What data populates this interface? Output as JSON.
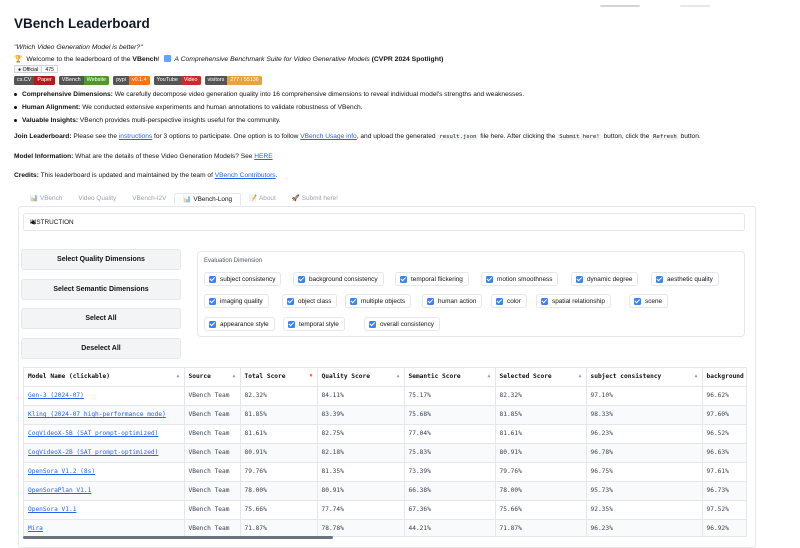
{
  "title": "VBench Leaderboard",
  "quote": "\"Which Video Generation Model is better?\"",
  "welcome": {
    "prefix": "Welcome to the leaderboard of the",
    "name": "VBench",
    "excl": "!",
    "paper_title": "A Comprehensive Benchmark Suite for Video Generative Models",
    "venue": "(CVPR 2024 Spotlight)"
  },
  "github": {
    "label": "Official",
    "count": "475"
  },
  "badges": [
    {
      "left": "cs.CV",
      "right": "Paper",
      "color": "#b31b1b"
    },
    {
      "left": "VBench",
      "right": "Website",
      "color": "#4c9a2a"
    },
    {
      "left": "pypi",
      "right": "v0.1.4",
      "color": "#f97316"
    },
    {
      "left": "YouTube",
      "right": "Video",
      "color": "#cc2b2b"
    },
    {
      "left": "visitors",
      "right": "277 / 55136",
      "color": "#e8a33a"
    }
  ],
  "bullets": [
    {
      "bold": "Comprehensive Dimensions:",
      "text": " We carefully decompose video generation quality into 16 comprehensive dimensions to reveal individual model's strengths and weaknesses."
    },
    {
      "bold": "Human Alignment:",
      "text": " We conducted extensive experiments and human annotations to validate robustness of VBench."
    },
    {
      "bold": "Valuable Insights:",
      "text": " VBench provides multi-perspective insights useful for the community."
    }
  ],
  "join": {
    "bold": "Join Leaderboard:",
    "t1": " Please see the ",
    "link1": "instructions",
    "t2": " for 3 options to participate. One option is to follow ",
    "link2": "VBench Usage info",
    "t3": ", and upload the generated ",
    "code1": "result.json",
    "t4": " file here. After clicking the ",
    "code2": "Submit here!",
    "t5": " button, click the ",
    "code3": "Refresh",
    "t6": " button."
  },
  "model_info": {
    "bold": "Model Information:",
    "text": " What are the details of these Video Generation Models? See ",
    "link": "HERE"
  },
  "credits": {
    "bold": "Credits:",
    "text": " This leaderboard is updated and maintained by the team of ",
    "link": "VBench Contributors",
    "end": "."
  },
  "tabs": [
    {
      "label": "VBench",
      "icon": "📊"
    },
    {
      "label": "Video Quality",
      "icon": ""
    },
    {
      "label": "VBench-I2V",
      "icon": ""
    },
    {
      "label": "VBench-Long",
      "icon": "📊"
    },
    {
      "label": "About",
      "icon": "📝"
    },
    {
      "label": "Submit here!",
      "icon": "🚀"
    }
  ],
  "instruction_label": "INSTRUCTION",
  "instruction_caret": "◀",
  "buttons": {
    "quality": "Select Quality Dimensions",
    "semantic": "Select Semantic Dimensions",
    "all": "Select All",
    "none": "Deselect All"
  },
  "eval_title": "Evaluation Dimension",
  "dimensions": [
    "subject consistency",
    "background consistency",
    "temporal flickering",
    "motion smoothness",
    "dynamic degree",
    "aesthetic quality",
    "imaging quality",
    "object class",
    "multiple objects",
    "human action",
    "color",
    "spatial relationship",
    "scene",
    "appearance style",
    "temporal style",
    "overall consistency"
  ],
  "table": {
    "headers": [
      "Model Name (clickable)",
      "Source",
      "Total Score",
      "Quality Score",
      "Semantic Score",
      "Selected Score",
      "subject consistency",
      "background consistency"
    ],
    "rows": [
      [
        "Gen-3 (2024-07)",
        "VBench Team",
        "82.32%",
        "84.11%",
        "75.17%",
        "82.32%",
        "97.10%",
        "96.62%"
      ],
      [
        "Kling (2024-07 high-performance mode)",
        "VBench Team",
        "81.85%",
        "83.39%",
        "75.68%",
        "81.85%",
        "98.33%",
        "97.60%"
      ],
      [
        "CogVideoX-5B (SAT prompt-optimized)",
        "VBench Team",
        "81.61%",
        "82.75%",
        "77.04%",
        "81.61%",
        "96.23%",
        "96.52%"
      ],
      [
        "CogVideoX-2B (SAT prompt-optimized)",
        "VBench Team",
        "80.91%",
        "82.18%",
        "75.83%",
        "80.91%",
        "96.78%",
        "96.63%"
      ],
      [
        "OpenSora V1.2 (8s)",
        "VBench Team",
        "79.76%",
        "81.35%",
        "73.39%",
        "79.76%",
        "96.75%",
        "97.61%"
      ],
      [
        "OpenSoraPlan V1.1",
        "VBench Team",
        "78.00%",
        "80.91%",
        "66.38%",
        "78.00%",
        "95.73%",
        "96.73%"
      ],
      [
        "OpenSora V1.1",
        "VBench Team",
        "75.66%",
        "77.74%",
        "67.36%",
        "75.66%",
        "92.35%",
        "97.52%"
      ],
      [
        "Mira",
        "VBench Team",
        "71.87%",
        "78.78%",
        "44.21%",
        "71.87%",
        "96.23%",
        "96.92%"
      ]
    ]
  }
}
